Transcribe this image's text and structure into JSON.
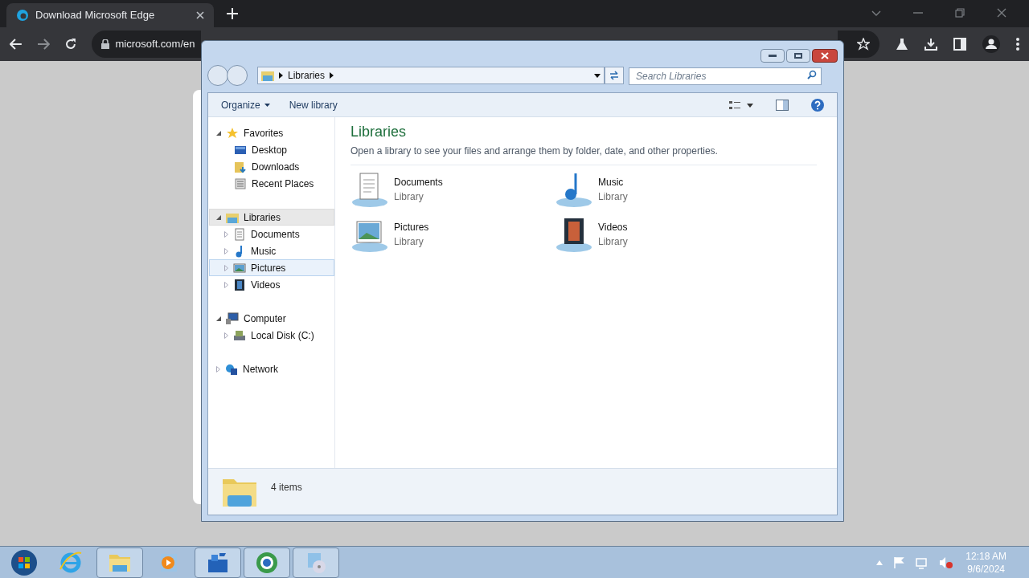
{
  "browser": {
    "tab_title": "Download Microsoft Edge",
    "url": "microsoft.com/en"
  },
  "explorer": {
    "breadcrumb": [
      "Libraries"
    ],
    "search": {
      "placeholder": "Search Libraries"
    },
    "toolbar": [
      {
        "label": "Organize",
        "dropdown": true
      },
      {
        "label": "New library",
        "dropdown": false
      }
    ],
    "nav_tree": [
      {
        "label": "Favorites",
        "kind": "favorites",
        "expanded": true,
        "selected": false,
        "hovered": false,
        "children": [
          {
            "label": "Desktop",
            "kind": "desktop",
            "selected": false,
            "hovered": false
          },
          {
            "label": "Downloads",
            "kind": "downloads",
            "selected": false,
            "hovered": false
          },
          {
            "label": "Recent Places",
            "kind": "recent",
            "selected": false,
            "hovered": false
          }
        ]
      },
      {
        "label": "Libraries",
        "kind": "libraries",
        "expanded": true,
        "selected": true,
        "hovered": false,
        "children": [
          {
            "label": "Documents",
            "kind": "documents",
            "expanded": false,
            "selected": false,
            "hovered": false
          },
          {
            "label": "Music",
            "kind": "music",
            "expanded": false,
            "selected": false,
            "hovered": false
          },
          {
            "label": "Pictures",
            "kind": "pictures",
            "expanded": false,
            "selected": false,
            "hovered": true
          },
          {
            "label": "Videos",
            "kind": "videos",
            "expanded": false,
            "selected": false,
            "hovered": false
          }
        ]
      },
      {
        "label": "Computer",
        "kind": "computer",
        "expanded": true,
        "selected": false,
        "hovered": false,
        "children": [
          {
            "label": "Local Disk (C:)",
            "kind": "disk",
            "expanded": false,
            "selected": false,
            "hovered": false
          }
        ]
      },
      {
        "label": "Network",
        "kind": "network",
        "expanded": false,
        "selected": false,
        "hovered": false
      }
    ],
    "heading": "Libraries",
    "description": "Open a library to see your files and arrange them by folder, date, and other properties.",
    "items": [
      {
        "name": "Documents",
        "type": "Library",
        "kind": "documents"
      },
      {
        "name": "Music",
        "type": "Library",
        "kind": "music"
      },
      {
        "name": "Pictures",
        "type": "Library",
        "kind": "pictures"
      },
      {
        "name": "Videos",
        "type": "Library",
        "kind": "videos"
      }
    ],
    "status": "4 items"
  },
  "taskbar": {
    "apps": [
      {
        "kind": "ie",
        "running": false
      },
      {
        "kind": "explorer",
        "running": true
      },
      {
        "kind": "media",
        "running": false
      },
      {
        "kind": "blocks",
        "running": true
      },
      {
        "kind": "globe",
        "running": true
      },
      {
        "kind": "disc",
        "running": true
      }
    ],
    "time": "12:18 AM",
    "date": "9/6/2024"
  }
}
